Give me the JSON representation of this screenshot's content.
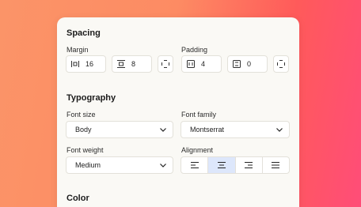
{
  "spacing": {
    "title": "Spacing",
    "margin": {
      "label": "Margin",
      "horizontal": "16",
      "vertical": "8"
    },
    "padding": {
      "label": "Padding",
      "horizontal": "4",
      "vertical": "0"
    }
  },
  "typography": {
    "title": "Typography",
    "font_size": {
      "label": "Font size",
      "value": "Body"
    },
    "font_family": {
      "label": "Font family",
      "value": "Montserrat"
    },
    "font_weight": {
      "label": "Font weight",
      "value": "Medium"
    },
    "alignment": {
      "label": "Alignment",
      "options": [
        "left",
        "center",
        "right",
        "justify"
      ],
      "selected": "center"
    }
  },
  "color": {
    "title": "Color"
  },
  "colors": {
    "accent_selected": "#dde7fb",
    "panel_bg": "#faf9f5"
  }
}
